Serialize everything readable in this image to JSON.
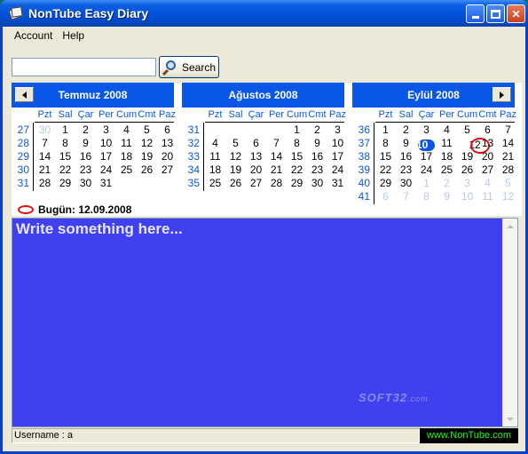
{
  "window": {
    "title": "NonTube Easy Diary"
  },
  "menu": {
    "items": [
      "Account",
      "Help"
    ]
  },
  "toolbar": {
    "search_value": "",
    "search_label": "Search"
  },
  "calendar": {
    "dow": [
      "Pzt",
      "Sal",
      "Çar",
      "Per",
      "Cum",
      "Cmt",
      "Paz"
    ],
    "months": [
      {
        "title": "Temmuz 2008",
        "weeks": [
          "27",
          "28",
          "29",
          "30",
          "31"
        ],
        "days": [
          [
            "30",
            "1",
            "2",
            "3",
            "4",
            "5",
            "6"
          ],
          [
            "7",
            "8",
            "9",
            "10",
            "11",
            "12",
            "13"
          ],
          [
            "14",
            "15",
            "16",
            "17",
            "18",
            "19",
            "20"
          ],
          [
            "21",
            "22",
            "23",
            "24",
            "25",
            "26",
            "27"
          ],
          [
            "28",
            "29",
            "30",
            "31",
            "",
            "",
            ""
          ]
        ],
        "other_month_cells": [
          "0-0"
        ]
      },
      {
        "title": "Ağustos 2008",
        "weeks": [
          "31",
          "32",
          "33",
          "34",
          "35"
        ],
        "days": [
          [
            "",
            "",
            "",
            "",
            "1",
            "2",
            "3"
          ],
          [
            "4",
            "5",
            "6",
            "7",
            "8",
            "9",
            "10"
          ],
          [
            "11",
            "12",
            "13",
            "14",
            "15",
            "16",
            "17"
          ],
          [
            "18",
            "19",
            "20",
            "21",
            "22",
            "23",
            "24"
          ],
          [
            "25",
            "26",
            "27",
            "28",
            "29",
            "30",
            "31"
          ]
        ],
        "other_month_cells": []
      },
      {
        "title": "Eylül 2008",
        "weeks": [
          "36",
          "37",
          "38",
          "39",
          "40",
          "41"
        ],
        "days": [
          [
            "1",
            "2",
            "3",
            "4",
            "5",
            "6",
            "7"
          ],
          [
            "8",
            "9",
            "10",
            "11",
            "12",
            "13",
            "14"
          ],
          [
            "15",
            "16",
            "17",
            "18",
            "19",
            "20",
            "21"
          ],
          [
            "22",
            "23",
            "24",
            "25",
            "26",
            "27",
            "28"
          ],
          [
            "29",
            "30",
            "1",
            "2",
            "3",
            "4",
            "5"
          ],
          [
            "6",
            "7",
            "8",
            "9",
            "10",
            "11",
            "12"
          ]
        ],
        "other_month_cells": [
          "4-2",
          "4-3",
          "4-4",
          "4-5",
          "4-6",
          "5-0",
          "5-1",
          "5-2",
          "5-3",
          "5-4",
          "5-5",
          "5-6"
        ],
        "selected_cell": "1-2",
        "today_cell": "1-4"
      }
    ],
    "today_label": "Bugün: 12.09.2008"
  },
  "editor": {
    "text": "Write something here..."
  },
  "watermark": {
    "text": "SOFT32",
    "suffix": ".com"
  },
  "status": {
    "user": "Username : a",
    "link": "www.NonTube.com"
  },
  "colors": {
    "editor_bg": "#4040f0",
    "header_bg": "#0a56e6",
    "today_ring": "#e01010",
    "link_text": "#1cff1c"
  }
}
